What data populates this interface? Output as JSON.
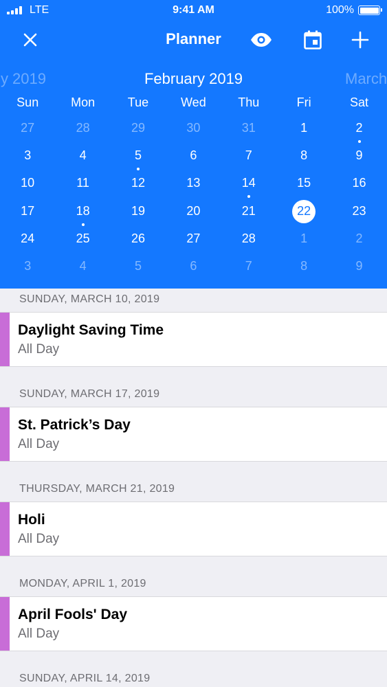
{
  "status_bar": {
    "carrier": "LTE",
    "time": "9:41 AM",
    "battery": "100%"
  },
  "nav": {
    "title": "Planner"
  },
  "calendar": {
    "prev_month": "y 2019",
    "current_month": "February 2019",
    "next_month": "March",
    "weekdays": [
      "Sun",
      "Mon",
      "Tue",
      "Wed",
      "Thu",
      "Fri",
      "Sat"
    ],
    "weeks": [
      [
        {
          "d": "27",
          "dim": true
        },
        {
          "d": "28",
          "dim": true
        },
        {
          "d": "29",
          "dim": true
        },
        {
          "d": "30",
          "dim": true
        },
        {
          "d": "31",
          "dim": true
        },
        {
          "d": "1"
        },
        {
          "d": "2",
          "dot": true
        }
      ],
      [
        {
          "d": "3"
        },
        {
          "d": "4"
        },
        {
          "d": "5",
          "dot": true
        },
        {
          "d": "6"
        },
        {
          "d": "7"
        },
        {
          "d": "8"
        },
        {
          "d": "9"
        }
      ],
      [
        {
          "d": "10"
        },
        {
          "d": "11"
        },
        {
          "d": "12"
        },
        {
          "d": "13"
        },
        {
          "d": "14",
          "dot": true
        },
        {
          "d": "15"
        },
        {
          "d": "16"
        }
      ],
      [
        {
          "d": "17"
        },
        {
          "d": "18",
          "dot": true
        },
        {
          "d": "19"
        },
        {
          "d": "20"
        },
        {
          "d": "21"
        },
        {
          "d": "22",
          "selected": true
        },
        {
          "d": "23"
        }
      ],
      [
        {
          "d": "24"
        },
        {
          "d": "25"
        },
        {
          "d": "26"
        },
        {
          "d": "27"
        },
        {
          "d": "28"
        },
        {
          "d": "1",
          "dim": true
        },
        {
          "d": "2",
          "dim": true
        }
      ],
      [
        {
          "d": "3",
          "dim": true
        },
        {
          "d": "4",
          "dim": true
        },
        {
          "d": "5",
          "dim": true
        },
        {
          "d": "6",
          "dim": true
        },
        {
          "d": "7",
          "dim": true
        },
        {
          "d": "8",
          "dim": true
        },
        {
          "d": "9",
          "dim": true
        }
      ]
    ]
  },
  "events": [
    {
      "date": "SUNDAY, MARCH 10, 2019",
      "title": "Daylight Saving Time",
      "time": "All Day"
    },
    {
      "date": "SUNDAY, MARCH 17, 2019",
      "title": "St. Patrick’s Day",
      "time": "All Day"
    },
    {
      "date": "THURSDAY, MARCH 21, 2019",
      "title": "Holi",
      "time": "All Day"
    },
    {
      "date": "MONDAY, APRIL 1, 2019",
      "title": "April Fools' Day",
      "time": "All Day"
    }
  ],
  "next_section_date": "SUNDAY, APRIL 14, 2019",
  "colors": {
    "header_bg": "#1478ff",
    "event_stripe": "#c86dd7",
    "list_bg": "#efeff4"
  },
  "icons": {
    "close": "close-icon",
    "view": "eye-icon",
    "today": "calendar-icon",
    "add": "plus-icon"
  }
}
